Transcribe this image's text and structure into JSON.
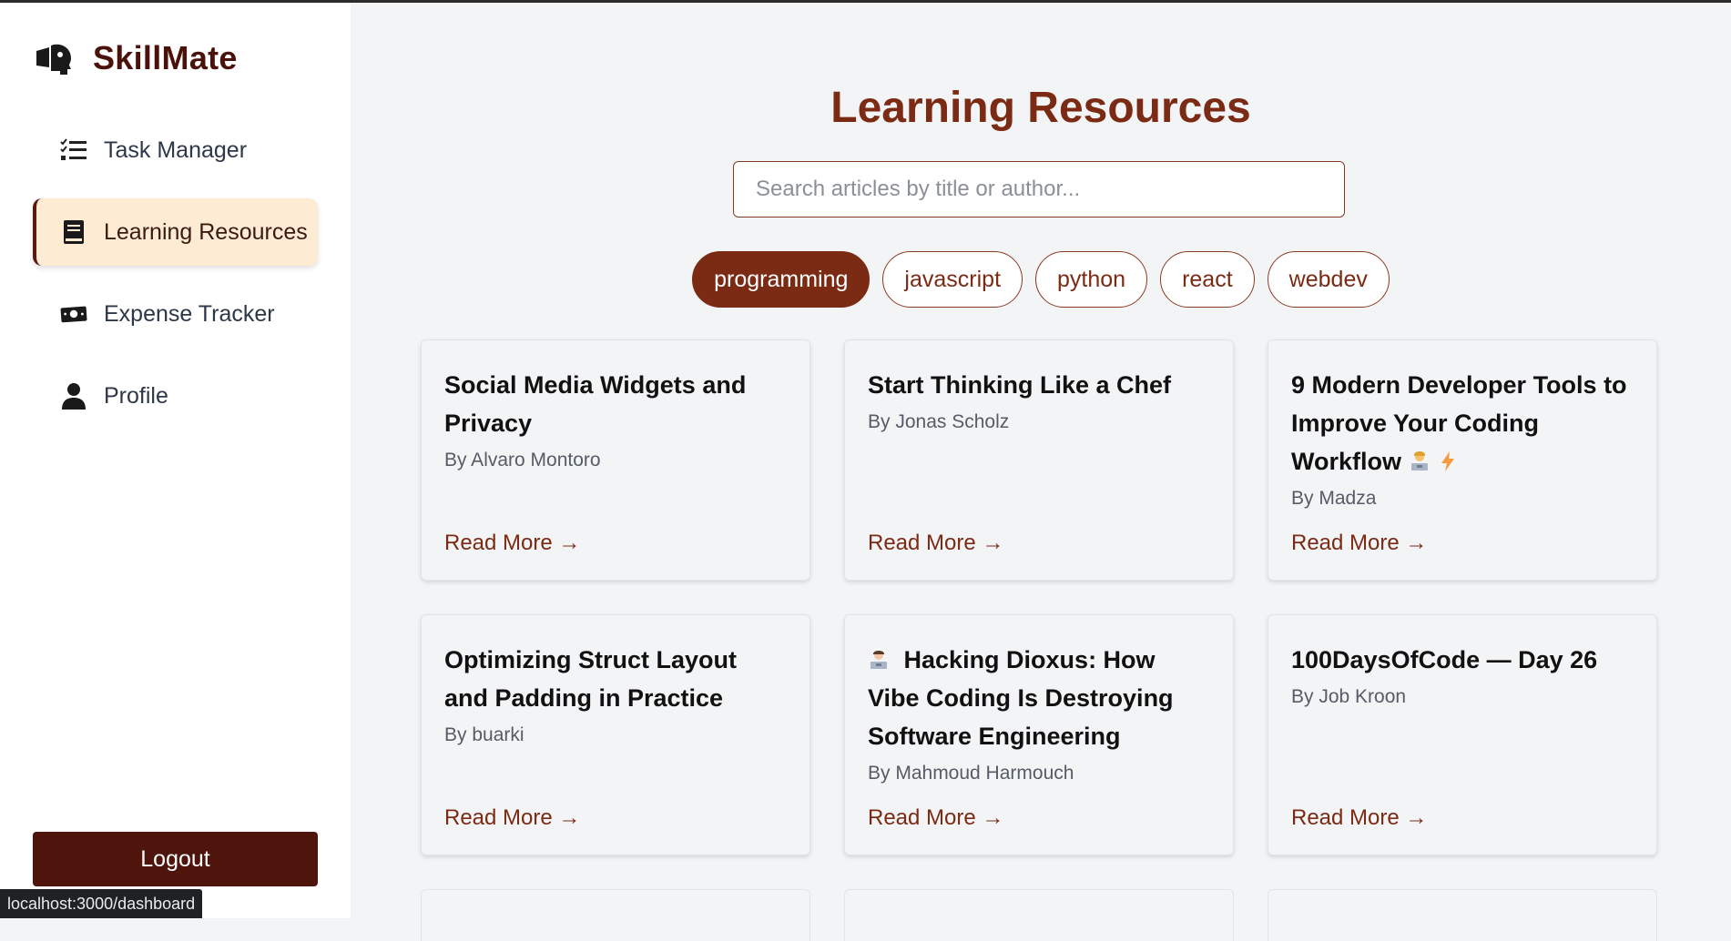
{
  "app": {
    "name": "SkillMate"
  },
  "sidebar": {
    "items": [
      {
        "label": "Task Manager",
        "icon": "task-list-icon",
        "active": false
      },
      {
        "label": "Learning Resources",
        "icon": "book-icon",
        "active": true
      },
      {
        "label": "Expense Tracker",
        "icon": "money-icon",
        "active": false
      },
      {
        "label": "Profile",
        "icon": "user-icon",
        "active": false
      }
    ],
    "logout_label": "Logout"
  },
  "main": {
    "title": "Learning Resources",
    "search": {
      "placeholder": "Search articles by title or author...",
      "value": ""
    },
    "tags": [
      {
        "label": "programming",
        "active": true
      },
      {
        "label": "javascript",
        "active": false
      },
      {
        "label": "python",
        "active": false
      },
      {
        "label": "react",
        "active": false
      },
      {
        "label": "webdev",
        "active": false
      }
    ],
    "read_more_label": "Read More →",
    "articles": [
      {
        "title": "Social Media Widgets and Privacy",
        "author": "By Alvaro Montoro"
      },
      {
        "title": "Start Thinking Like a Chef",
        "author": "By Jonas Scholz"
      },
      {
        "title": "9 Modern Developer Tools to Improve Your Coding Workflow",
        "author": "By Madza",
        "trailing_emojis": [
          "technologist-emoji",
          "lightning-emoji"
        ]
      },
      {
        "title": "Optimizing Struct Layout and Padding in Practice",
        "author": "By buarki"
      },
      {
        "title": "Hacking Dioxus: How Vibe Coding Is Destroying Software Engineering",
        "author": "By Mahmoud Harmouch",
        "leading_emoji": "technologist-emoji"
      },
      {
        "title": "100DaysOfCode — Day 26",
        "author": "By Job Kroon"
      }
    ]
  },
  "status_bar": {
    "url": "localhost:3000/dashboard"
  },
  "colors": {
    "brand": "#4a120b",
    "accent": "#7b2a14",
    "active_nav_bg": "#fdebd3",
    "logout_bg": "#4f150d"
  }
}
